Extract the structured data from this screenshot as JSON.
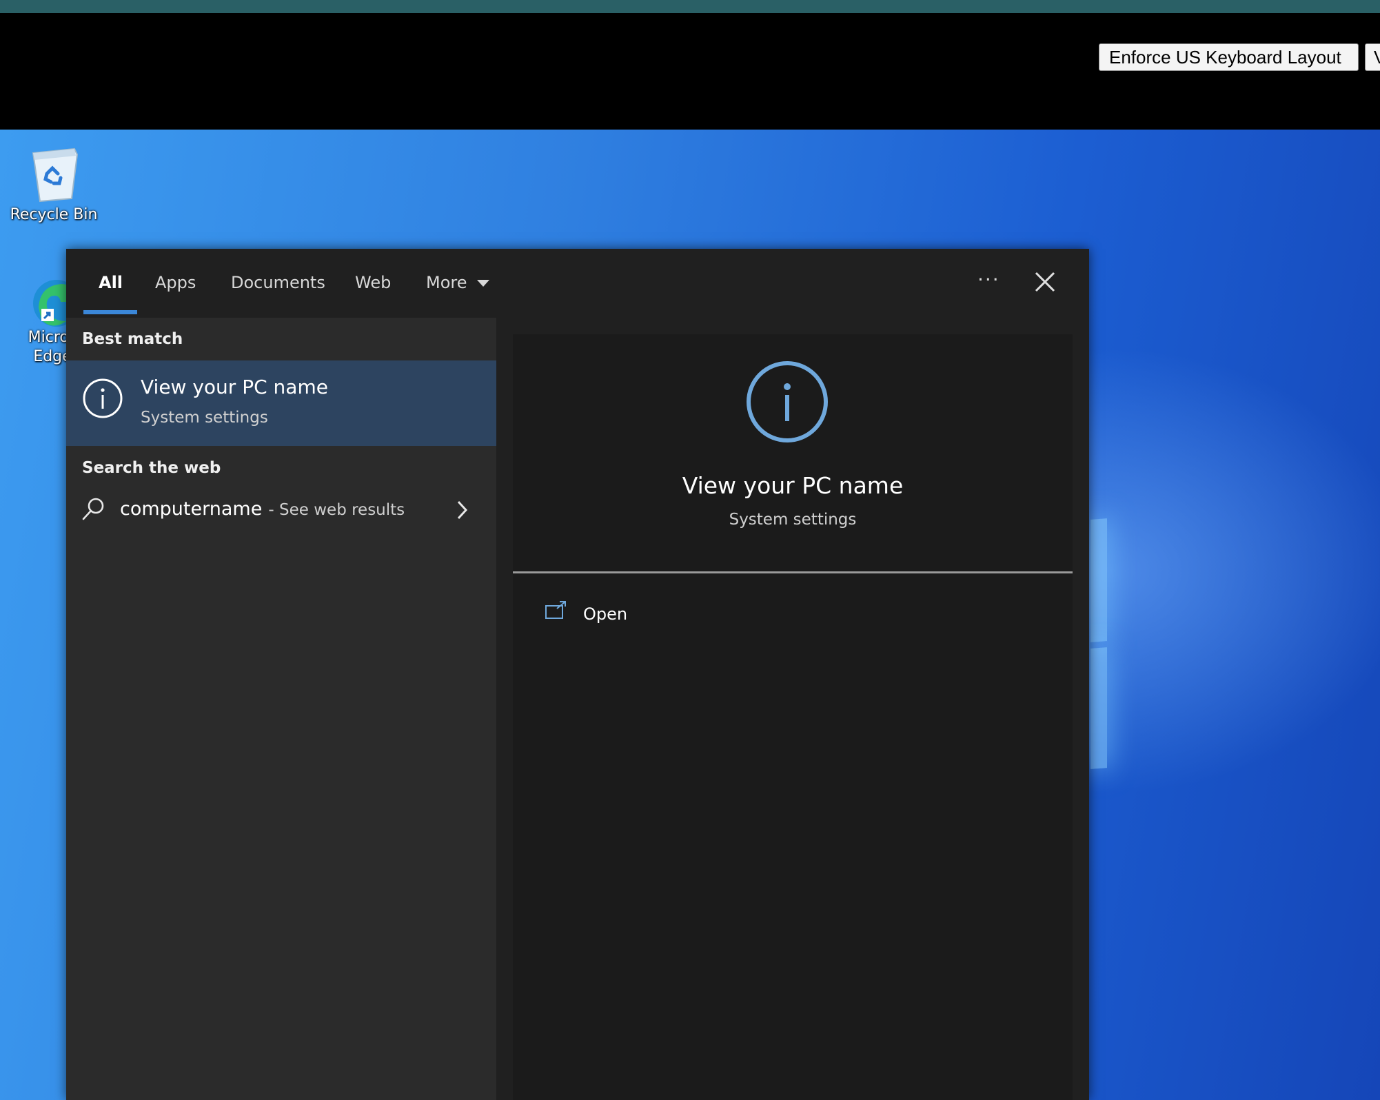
{
  "toolbar": {
    "enforce_keyboard_label": "Enforce US Keyboard Layout",
    "next_button_label": "V"
  },
  "desktop": {
    "icons": [
      {
        "label": "Recycle Bin"
      },
      {
        "label_line1": "Micros",
        "label_line2": "Edge"
      }
    ]
  },
  "search": {
    "tabs": [
      {
        "label": "All",
        "active": true
      },
      {
        "label": "Apps"
      },
      {
        "label": "Documents"
      },
      {
        "label": "Web"
      },
      {
        "label": "More"
      }
    ],
    "more_options": "···",
    "best_match_header": "Best match",
    "best_match": {
      "title": "View your PC name",
      "subtitle": "System settings"
    },
    "web_header": "Search the web",
    "web_result": {
      "query": "computername",
      "suffix": "- See web results"
    },
    "preview": {
      "title": "View your PC name",
      "subtitle": "System settings",
      "actions": [
        {
          "label": "Open"
        }
      ]
    }
  },
  "colors": {
    "accent": "#3b87d8",
    "selection": "#2d4460",
    "panel": "#202020"
  }
}
